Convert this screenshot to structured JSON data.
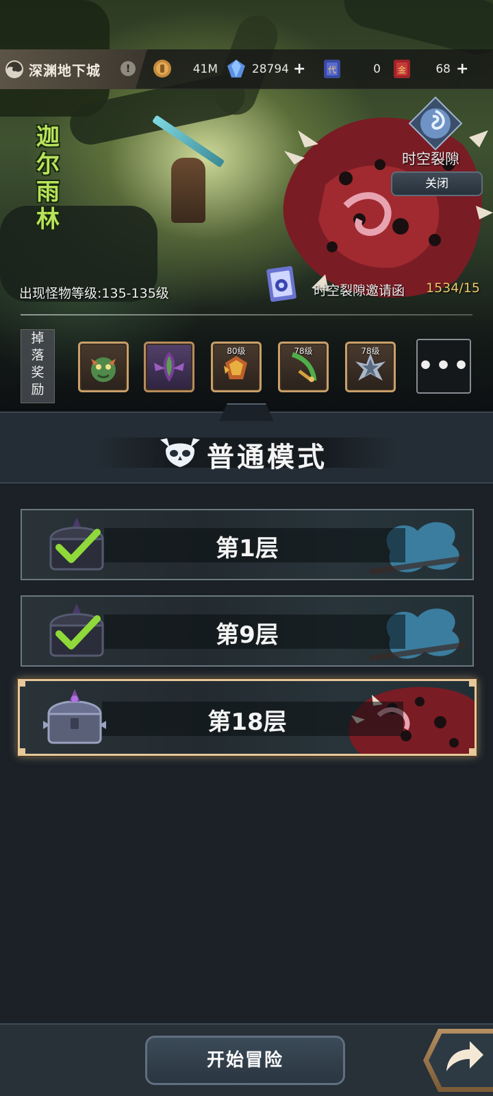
{
  "header": {
    "title": "深渊地下城",
    "info_glyph": "!"
  },
  "resources": {
    "gold": "41M",
    "diamonds": "28794",
    "ticket_dai": "0",
    "ticket_jin": "68",
    "plus": "+"
  },
  "area": {
    "name_chars": [
      "迦",
      "尔",
      "雨",
      "林"
    ],
    "monster_level": "出现怪物等级:135-135级"
  },
  "rift": {
    "title": "时空裂隙",
    "close_label": "关闭",
    "invite_label": "时空裂隙邀请函",
    "invite_count": "1534/15"
  },
  "drops": {
    "label_chars": [
      "掉",
      "落",
      "奖",
      "励"
    ],
    "items": [
      {
        "level": ""
      },
      {
        "level": ""
      },
      {
        "level": "80级"
      },
      {
        "level": "78级"
      },
      {
        "level": "78级"
      }
    ],
    "more": "•••"
  },
  "mode": {
    "title": "普通模式"
  },
  "floors": [
    {
      "label": "第1层",
      "completed": true
    },
    {
      "label": "第9层",
      "completed": true
    },
    {
      "label": "第18层",
      "completed": false,
      "selected": true
    }
  ],
  "footer": {
    "start_label": "开始冒险"
  },
  "colors": {
    "accent_green": "#b8e35a",
    "invite_count": "#f0c86a",
    "selected_border": "#e7c89a"
  }
}
